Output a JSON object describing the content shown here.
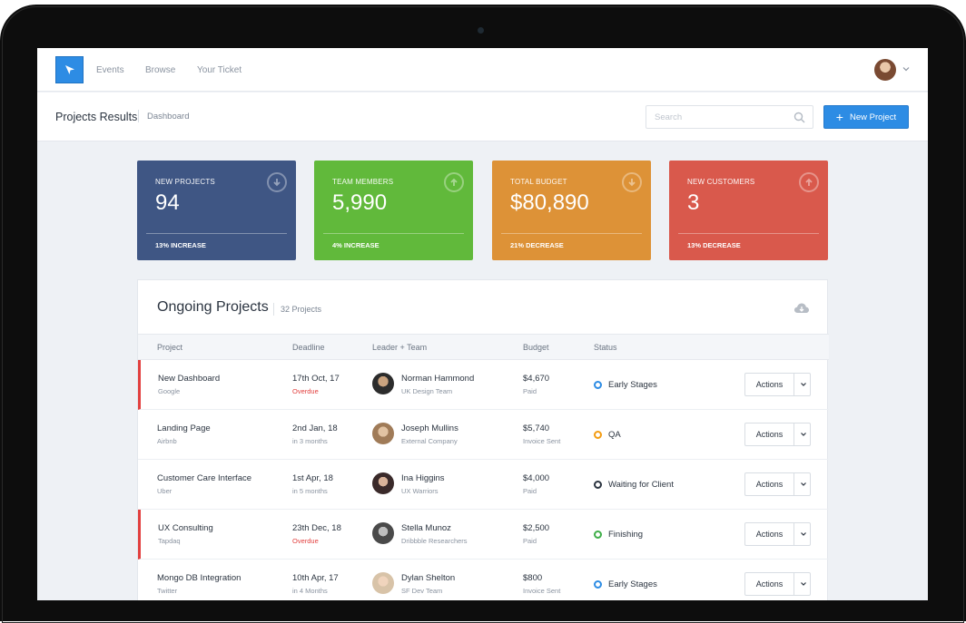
{
  "nav": {
    "links": [
      "Events",
      "Browse",
      "Your Ticket"
    ]
  },
  "header": {
    "title": "Projects Results",
    "breadcrumb": "Dashboard",
    "search_placeholder": "Search",
    "new_project_label": "New Project"
  },
  "stats": [
    {
      "label": "NEW PROJECTS",
      "value": "94",
      "foot": "13% INCREASE",
      "color": "#3f5684",
      "trend": "down"
    },
    {
      "label": "TEAM MEMBERS",
      "value": "5,990",
      "foot": "4% INCREASE",
      "color": "#61b93b",
      "trend": "up"
    },
    {
      "label": "TOTAL BUDGET",
      "value": "$80,890",
      "foot": "21% DECREASE",
      "color": "#dd9237",
      "trend": "down"
    },
    {
      "label": "NEW CUSTOMERS",
      "value": "3",
      "foot": "13% DECREASE",
      "color": "#d9594c",
      "trend": "up"
    }
  ],
  "projects": {
    "title": "Ongoing Projects",
    "count": "32 Projects",
    "columns": [
      "Project",
      "Deadline",
      "Leader + Team",
      "Budget",
      "Status"
    ],
    "actions_label": "Actions",
    "rows": [
      {
        "project": "New Dashboard",
        "client": "Google",
        "deadline": "17th Oct, 17",
        "deadline_note": "Overdue",
        "overdue": true,
        "leader": "Norman Hammond",
        "team": "UK Design Team",
        "budget": "$4,670",
        "budget_note": "Paid",
        "status": "Early Stages",
        "status_color": "#2d8ce4"
      },
      {
        "project": "Landing Page",
        "client": "Airbnb",
        "deadline": "2nd Jan, 18",
        "deadline_note": "in 3 months",
        "overdue": false,
        "leader": "Joseph Mullins",
        "team": "External Company",
        "budget": "$5,740",
        "budget_note": "Invoice Sent",
        "status": "QA",
        "status_color": "#f39c12"
      },
      {
        "project": "Customer Care Interface",
        "client": "Uber",
        "deadline": "1st Apr, 18",
        "deadline_note": "in 5 months",
        "overdue": false,
        "leader": "Ina Higgins",
        "team": "UX Warriors",
        "budget": "$4,000",
        "budget_note": "Paid",
        "status": "Waiting for Client",
        "status_color": "#2b3440"
      },
      {
        "project": "UX Consulting",
        "client": "Tapdaq",
        "deadline": "23th Dec, 18",
        "deadline_note": "Overdue",
        "overdue": true,
        "leader": "Stella Munoz",
        "team": "Dribbble Researchers",
        "budget": "$2,500",
        "budget_note": "Paid",
        "status": "Finishing",
        "status_color": "#3fae49"
      },
      {
        "project": "Mongo DB Integration",
        "client": "Twitter",
        "deadline": "10th Apr, 17",
        "deadline_note": "in 4 Months",
        "overdue": false,
        "leader": "Dylan Shelton",
        "team": "SF Dev Team",
        "budget": "$800",
        "budget_note": "Invoice Sent",
        "status": "Early Stages",
        "status_color": "#2d8ce4"
      }
    ]
  }
}
